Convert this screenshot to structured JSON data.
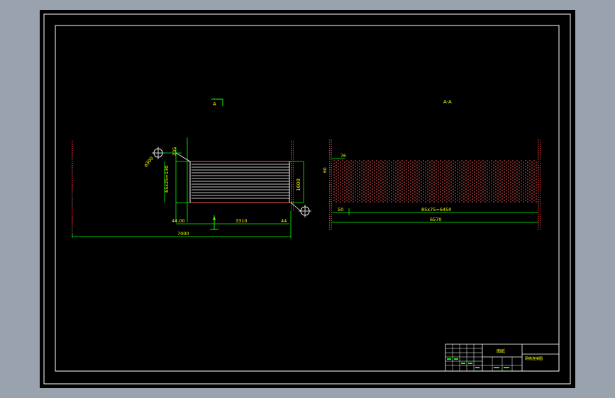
{
  "drawing": {
    "view_labels": {
      "left_section": "A",
      "right_section": "A-A",
      "cut_marker": "A"
    },
    "left_view": {
      "diameter_label": "ø300",
      "top_offset": "235",
      "left_vertical": "65x25=130",
      "right_vertical": "1600",
      "dim_left": "44.00",
      "dim_middle": "3310",
      "dim_right": "44",
      "overall_width": "7000"
    },
    "right_view": {
      "top_small": "76",
      "left_small": "60",
      "dim_left": "50",
      "dim_middle": "85x75=6450",
      "overall_width": "6570"
    },
    "title_block": {
      "title": "图纸",
      "drawing_name": "网络连接图"
    }
  },
  "colors": {
    "background": "#000000",
    "frame": "#ffffff",
    "dimension": "#00ff00",
    "text": "#ffff00",
    "hatch": "#ff5555",
    "outer": "#9aa3ad"
  }
}
